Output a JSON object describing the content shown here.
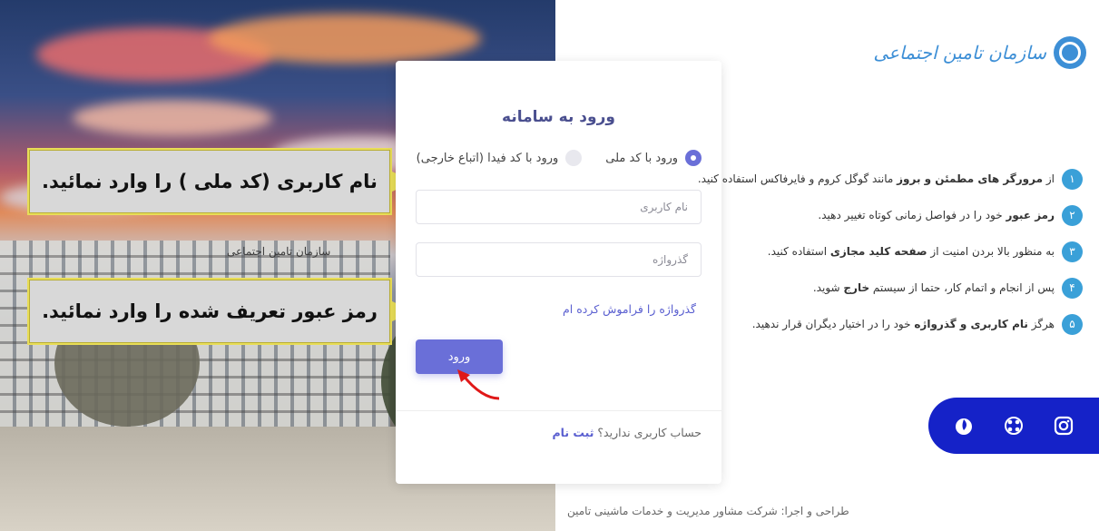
{
  "callouts": {
    "username_hint": "نام کاربری (کد ملی ) را وارد نمائید.",
    "password_hint": "رمز عبور تعریف شده را وارد نمائید."
  },
  "background": {
    "sign_text": "سازمان تامین اجتماعی"
  },
  "login": {
    "title": "ورود به سامانه",
    "radio_national": "ورود با کد ملی",
    "radio_foreign": "ورود با کد فیدا (اتباع خارجی)",
    "username_placeholder": "نام کاربری",
    "password_placeholder": "گذرواژه",
    "forgot_link": "گذرواژه را فراموش کرده ام",
    "submit_label": "ورود",
    "signup_question": "حساب کاربری ندارید؟",
    "signup_link": "ثبت نام"
  },
  "brand": {
    "logo_text": "سازمان تامین اجتماعی"
  },
  "tips": [
    {
      "num": "۱",
      "before": "از ",
      "bold": "مرورگر های مطمئن و بروز",
      "after": " مانند گوگل کروم و فایرفاکس استفاده کنید."
    },
    {
      "num": "۲",
      "before": "",
      "bold": "رمز عبور",
      "after": " خود را در فواصل زمانی کوتاه تغییر دهید."
    },
    {
      "num": "۳",
      "before": "به منظور بالا بردن امنیت از ",
      "bold": "صفحه کلید مجازی",
      "after": " استفاده کنید."
    },
    {
      "num": "۴",
      "before": "پس از انجام و اتمام کار، حتما از سیستم ",
      "bold": "خارج",
      "after": " شوید."
    },
    {
      "num": "۵",
      "before": "هرگز ",
      "bold": "نام کاربری و گذرواژه",
      "after": " خود را در اختیار دیگران قرار ندهید."
    }
  ],
  "social": [
    "instagram-icon",
    "aparat-icon",
    "soroush-icon"
  ],
  "footer": "طراحی و اجرا: شرکت مشاور مدیریت و خدمات ماشینی تامین",
  "colors": {
    "accent": "#6a6fd8",
    "tip_badge": "#3aa0d8",
    "social_bar": "#1522c8"
  }
}
